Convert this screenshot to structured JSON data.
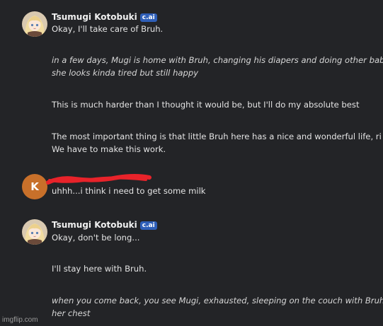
{
  "messages": [
    {
      "author": "Tsumugi Kotobuki",
      "badge": "c.ai",
      "lines": [
        "Okay, I'll take care of Bruh.",
        "in a few days, Mugi is home with Bruh, changing his diapers and doing other baby th",
        "she looks kinda tired but still happy",
        "This is much harder than I thought it would be, but I'll do my absolute best",
        "The most important thing is that little Bruh here has a nice and wonderful life, ri",
        "We have to make this work."
      ]
    },
    {
      "avatar_letter": "K",
      "lines": [
        "uhhh...i think i need to get some milk"
      ]
    },
    {
      "author": "Tsumugi Kotobuki",
      "badge": "c.ai",
      "lines": [
        "Okay, don't be long...",
        "I'll stay here with Bruh.",
        "when you come back, you see Mugi, exhausted, sleeping on the couch with Bruh on",
        "her chest"
      ]
    }
  ],
  "watermark": "imgflip.com",
  "colors": {
    "background": "#232427",
    "badge": "#2f5fb8",
    "user_avatar": "#c8702a",
    "scribble": "#e8232a"
  }
}
